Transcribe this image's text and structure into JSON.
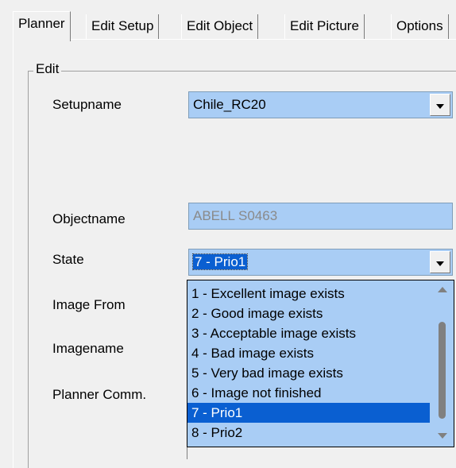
{
  "tabs": [
    {
      "label": "Planner",
      "active": true
    },
    {
      "label": "Edit Setup"
    },
    {
      "label": "Edit Object"
    },
    {
      "label": "Edit Picture"
    },
    {
      "label": "Options"
    }
  ],
  "group": {
    "title": "Edit"
  },
  "form": {
    "setupname_label": "Setupname",
    "setupname_value": "Chile_RC20",
    "objectname_label": "Objectname",
    "objectname_value": "ABELL S0463",
    "state_label": "State",
    "state_value": "7 - Prio1",
    "image_from_label": "Image From",
    "imagename_label": "Imagename",
    "planner_comm_label": "Planner Comm."
  },
  "state_options": [
    "1 - Excellent image exists",
    "2 - Good image exists",
    "3 - Acceptable image exists",
    "4 - Bad image exists",
    "5 - Very bad image exists",
    "6 - Image not finished",
    "7 - Prio1",
    "8 - Prio2"
  ],
  "colors": {
    "field_bg": "#a9cdf5",
    "selection": "#0a5fd1"
  }
}
